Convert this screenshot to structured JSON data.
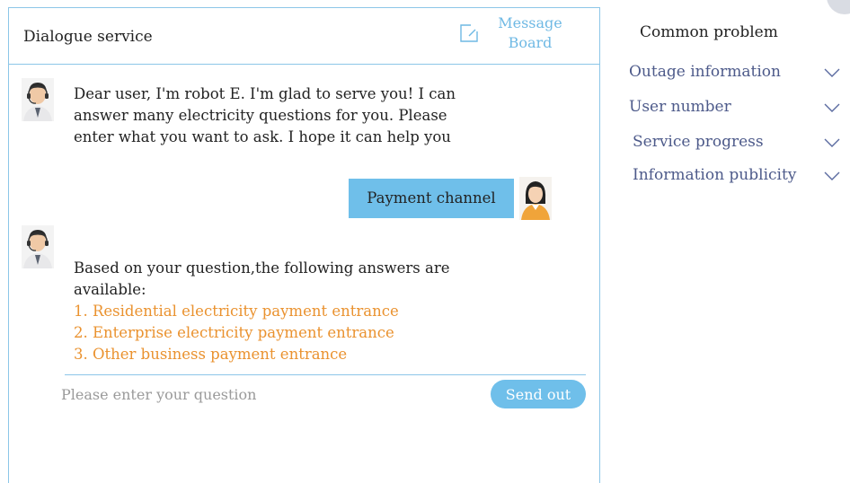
{
  "chat": {
    "title": "Dialogue service",
    "message_board": {
      "line1": "Message",
      "line2": "Board"
    },
    "messages": [
      {
        "from": "bot",
        "text": "Dear user, I'm robot E. I'm glad to serve you! I can answer many electricity questions for you. Please enter what you want to ask. I hope it can help you"
      },
      {
        "from": "user",
        "text": "Payment channel"
      },
      {
        "from": "bot",
        "text": "Based on your question,the following answers are available:",
        "answers": [
          "1. Residential electricity payment entrance",
          "2. Enterprise electricity payment entrance",
          "3. Other business payment entrance"
        ]
      }
    ],
    "input": {
      "placeholder": "Please enter your question",
      "value": ""
    },
    "send_label": "Send out"
  },
  "sidebar": {
    "title": "Common problem",
    "items": [
      {
        "label": "Outage information"
      },
      {
        "label": "User number"
      },
      {
        "label": "Service progress"
      },
      {
        "label": "Information publicity"
      }
    ]
  },
  "colors": {
    "border": "#8cc6e8",
    "accent": "#6fbfea",
    "link": "#ea922f",
    "faq_text": "#4d5a8a"
  }
}
